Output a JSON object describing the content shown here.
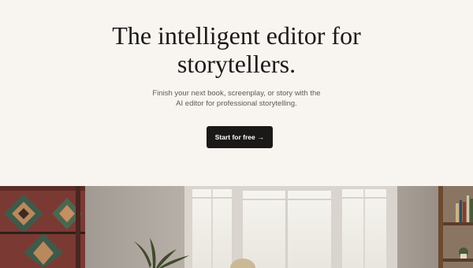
{
  "hero": {
    "headline_line1": "The intelligent editor for",
    "headline_line2": "storytellers.",
    "subtitle_line1": "Finish your next book, screenplay, or story with the",
    "subtitle_line2": "AI editor for professional storytelling.",
    "cta_label": "Start for free",
    "cta_arrow": "→"
  },
  "colors": {
    "background": "#f8f4f0",
    "headline": "#1c1a18",
    "button": "#1a1918"
  }
}
